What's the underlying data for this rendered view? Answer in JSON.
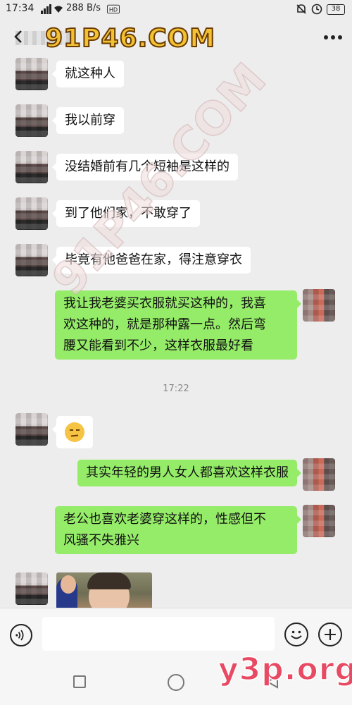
{
  "status_bar": {
    "time": "17:34",
    "net_speed": "288 B/s",
    "battery": "38"
  },
  "watermarks": {
    "top": "91P46.COM",
    "diagonal": "91P46.COM",
    "bottom": "y3p.org"
  },
  "messages": [
    {
      "side": "in",
      "text": "就这种人"
    },
    {
      "side": "in",
      "text": "我以前穿"
    },
    {
      "side": "in",
      "text": "没结婚前有几个短袖是这样的"
    },
    {
      "side": "in",
      "text": "到了他们家，不敢穿了"
    },
    {
      "side": "in",
      "text": "毕竟有他爸爸在家，得注意穿衣"
    },
    {
      "side": "out",
      "lines": [
        "我让我老婆买衣服就买这种的，我喜",
        "欢这种的，就是那种露一点。然后弯",
        "腰又能看到不少，这样衣服最好看"
      ]
    },
    {
      "side": "out_2",
      "text": "其实年轻的男人女人都喜欢这样衣服"
    },
    {
      "side": "out_3",
      "lines": [
        "老公也喜欢老婆穿这样的，性感但不",
        "风骚不失雅兴"
      ]
    }
  ],
  "timestamp": "17:22",
  "icons": {
    "status": [
      "signal-icon",
      "wifi-icon",
      "hd-icon",
      "alarm-icon",
      "battery-icon"
    ],
    "header": [
      "back-arrow-icon",
      "more-icon"
    ],
    "input": [
      "voice-icon",
      "emoji-icon",
      "plus-icon"
    ],
    "nav": [
      "nav-square-icon",
      "nav-home-icon",
      "nav-back-icon"
    ]
  }
}
